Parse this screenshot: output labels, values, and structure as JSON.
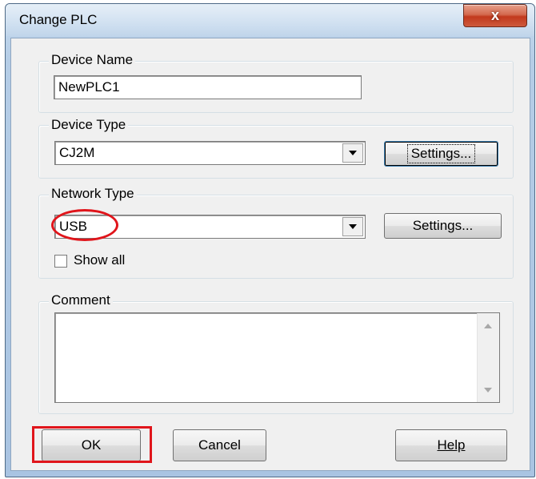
{
  "window": {
    "title": "Change PLC",
    "close_glyph": "x"
  },
  "device_name": {
    "legend": "Device Name",
    "value": "NewPLC1"
  },
  "device_type": {
    "legend": "Device Type",
    "value": "CJ2M",
    "settings_label": "Settings..."
  },
  "network_type": {
    "legend": "Network Type",
    "value": "USB",
    "settings_label": "Settings...",
    "show_all_label": "Show all",
    "show_all_checked": false
  },
  "comment": {
    "legend": "Comment",
    "value": ""
  },
  "buttons": {
    "ok_label": "OK",
    "cancel_label": "Cancel",
    "help_label": "Help"
  },
  "annotations": {
    "highlight_color": "#e0151b"
  }
}
